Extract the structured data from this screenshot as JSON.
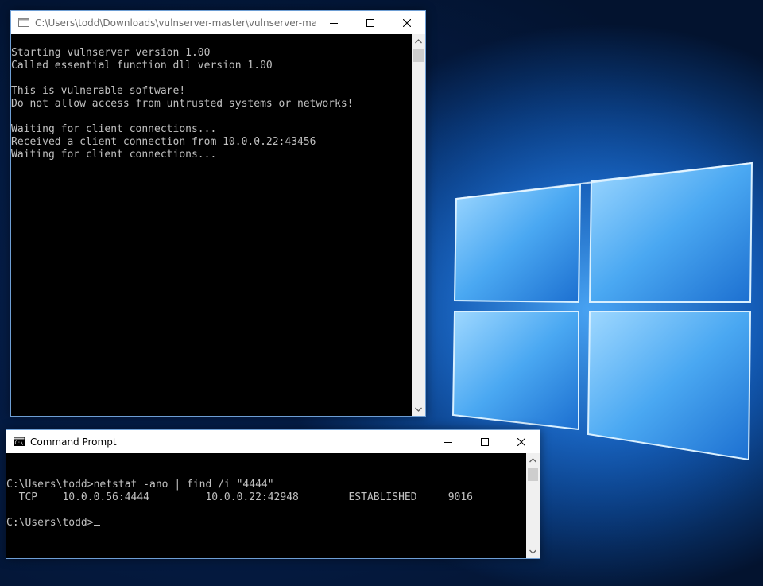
{
  "wallpaper": {
    "name": "Windows 10 hero wallpaper"
  },
  "vuln_window": {
    "title": "C:\\Users\\todd\\Downloads\\vulnserver-master\\vulnserver-master\\...",
    "icon": "console-app-icon",
    "lines": [
      "Starting vulnserver version 1.00",
      "Called essential function dll version 1.00",
      "",
      "This is vulnerable software!",
      "Do not allow access from untrusted systems or networks!",
      "",
      "Waiting for client connections...",
      "Received a client connection from 10.0.0.22:43456",
      "Waiting for client connections..."
    ]
  },
  "cmd_window": {
    "title": "Command Prompt",
    "icon": "cmd-icon",
    "lines": [
      "C:\\Users\\todd>netstat -ano | find /i \"4444\"",
      "  TCP    10.0.0.56:4444         10.0.0.22:42948        ESTABLISHED     9016",
      ""
    ],
    "prompt": "C:\\Users\\todd>"
  },
  "colors": {
    "console_bg": "#000000",
    "console_text": "#c0c0c0",
    "titlebar_bg": "#ffffff",
    "accent": "#1a82e2"
  }
}
